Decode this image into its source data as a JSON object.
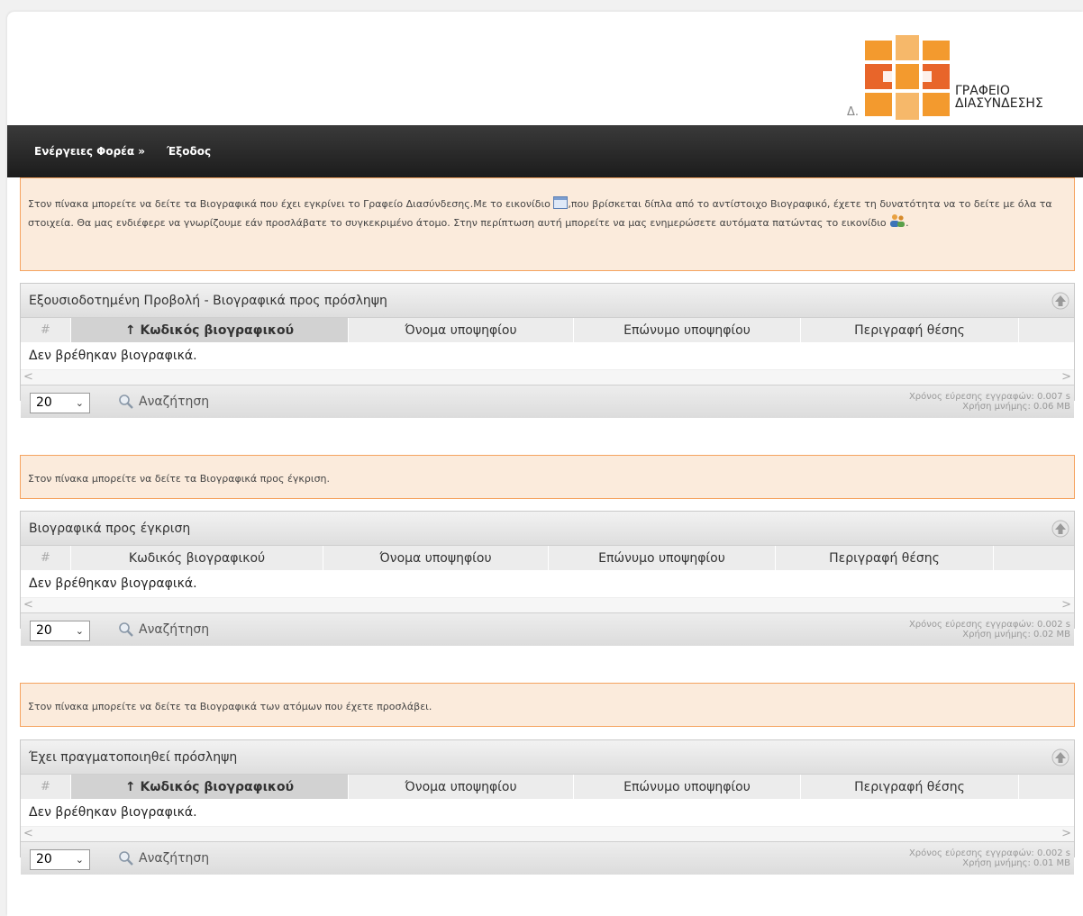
{
  "header": {
    "logo_text_line1": "ΓΡΑΦΕΙΟ",
    "logo_text_line2": "ΔΙΑΣΥΝΔΕΣΗΣ",
    "logo_sub": "Δ.",
    "logo_colors": [
      "#f39a2e",
      "#e8652a",
      "#f6b86a"
    ]
  },
  "nav": {
    "actions": "Ενέργειες Φορέα »",
    "logout": "Έξοδος"
  },
  "info1": {
    "part1": "Στον πίνακα μπορείτε να δείτε τα Βιογραφικά που έχει εγκρίνει το Γραφείο Διασύνδεσης.Με το εικονίδιο ",
    "part2": ",που βρίσκεται δίπλα από το αντίστοιχο Βιογραφικό, έχετε τη δυνατότητα να το δείτε με όλα τα στοιχεία. Θα μας ενδιέφερε να γνωρίζουμε εάν προσλάβατε το συγκεκριμένο άτομο. Στην περίπτωση αυτή μπορείτε να μας ενημερώσετε αυτόματα πατώντας το εικονίδιο ",
    "part3": "."
  },
  "info2": {
    "text": "Στον πίνακα μπορείτε να δείτε τα Βιογραφικά προς έγκριση."
  },
  "info3": {
    "text": "Στον πίνακα μπορείτε να δείτε τα Βιογραφικά των ατόμων που έχετε προσλάβει."
  },
  "panels": [
    {
      "title": "Εξουσιοδοτημένη Προβολή - Βιογραφικά προς πρόσληψη",
      "columns": [
        "#",
        "↑ Κωδικός βιογραφικού",
        "Όνομα υποψηφίου",
        "Επώνυμο υποψηφίου",
        "Περιγραφή θέσης"
      ],
      "empty": "Δεν βρέθηκαν βιογραφικά.",
      "page_size": "20",
      "search": "Αναζήτηση",
      "stats_time": "Χρόνος εύρεσης εγγραφών: 0.007 s",
      "stats_mem": "Χρήση μνήμης: 0.06 MB"
    },
    {
      "title": "Βιογραφικά προς έγκριση",
      "columns": [
        "#",
        "Κωδικός βιογραφικού",
        "Όνομα υποψηφίου",
        "Επώνυμο υποψηφίου",
        "Περιγραφή θέσης"
      ],
      "empty": "Δεν βρέθηκαν βιογραφικά.",
      "page_size": "20",
      "search": "Αναζήτηση",
      "stats_time": "Χρόνος εύρεσης εγγραφών: 0.002 s",
      "stats_mem": "Χρήση μνήμης: 0.02 MB"
    },
    {
      "title": "Έχει πραγματοποιηθεί πρόσληψη",
      "columns": [
        "#",
        "↑ Κωδικός βιογραφικού",
        "Όνομα υποψηφίου",
        "Επώνυμο υποψηφίου",
        "Περιγραφή θέσης"
      ],
      "empty": "Δεν βρέθηκαν βιογραφικά.",
      "page_size": "20",
      "search": "Αναζήτηση",
      "stats_time": "Χρόνος εύρεσης εγγραφών: 0.002 s",
      "stats_mem": "Χρήση μνήμης: 0.01 MB"
    }
  ],
  "icons": {
    "view_cv": "calendar-card-icon",
    "mark_hired": "users-icon",
    "collapse": "collapse-up-icon",
    "search": "magnifier-icon"
  }
}
